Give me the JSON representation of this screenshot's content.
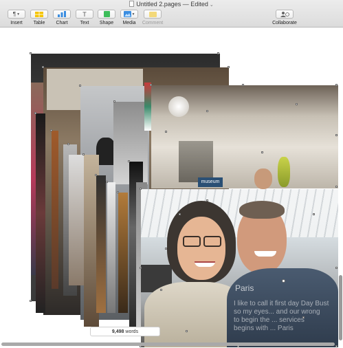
{
  "window": {
    "title": "Untitled 2.pages — Edited",
    "title_chevron": "⌄"
  },
  "toolbar": {
    "insert": {
      "label": "Insert",
      "glyph": "¶"
    },
    "table": {
      "label": "Table"
    },
    "chart": {
      "label": "Chart"
    },
    "text": {
      "label": "Text",
      "glyph": "T"
    },
    "shape": {
      "label": "Shape"
    },
    "media": {
      "label": "Media"
    },
    "comment": {
      "label": "Comment"
    },
    "collaborate": {
      "label": "Collaborate"
    }
  },
  "document": {
    "overlay_title": "Paris",
    "overlay_lines": [
      "I like to call it first day Day Bust",
      "so my eyes... and our wrong",
      "to begin the ... services",
      "begins with ... Paris"
    ],
    "sign_text": "museum"
  },
  "status": {
    "word_count": "9,498",
    "word_label": "words"
  },
  "colors": {
    "accent_yellow": "#f5c400",
    "accent_green": "#3dbd5a",
    "accent_blue": "#3a8de0"
  }
}
